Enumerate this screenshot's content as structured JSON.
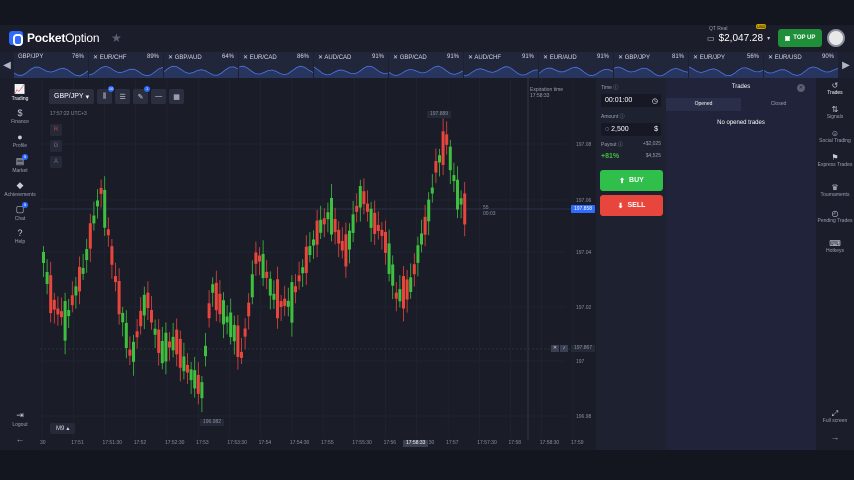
{
  "header": {
    "logo_bold": "Pocket",
    "logo_light": "Option",
    "account_type": "QT Real",
    "balance": "$2,047.28",
    "currency_badge": "USD",
    "topup_label": "TOP UP"
  },
  "assets": [
    {
      "name": "GBP/JPY",
      "pct": "76%"
    },
    {
      "name": "EUR/CHF",
      "pct": "89%"
    },
    {
      "name": "GBP/AUD",
      "pct": "64%"
    },
    {
      "name": "EUR/CAD",
      "pct": "86%"
    },
    {
      "name": "AUD/CAD",
      "pct": "91%"
    },
    {
      "name": "GBP/CAD",
      "pct": "91%"
    },
    {
      "name": "AUD/CHF",
      "pct": "91%"
    },
    {
      "name": "EUR/AUD",
      "pct": "91%"
    },
    {
      "name": "GBP/JPY",
      "pct": "81%"
    },
    {
      "name": "EUR/JPY",
      "pct": "56%"
    },
    {
      "name": "EUR/USD",
      "pct": "90%"
    }
  ],
  "left_sidebar": {
    "trading": "Trading",
    "finance": "Finance",
    "profile": "Profile",
    "market": "Market",
    "achievements": "Achievements",
    "chat": "Chat",
    "help": "Help",
    "logout": "Logout",
    "market_badge": "5",
    "chat_badge": "5"
  },
  "chart_toolbar": {
    "pair": "GBP/JPY",
    "indicators_badge": "10",
    "draw_badge": "1",
    "timestamp": "17:57:22 UTC+3",
    "timeframe": "M9"
  },
  "chart_labels": {
    "expiration_label": "Expiration time",
    "expiration_time": "17:58:33",
    "current_price": "197.858",
    "high_tag": "197.889",
    "low_tag": "196.982",
    "mid_tag": "197.867",
    "countdown_top": "55",
    "countdown_bottom": "00:03",
    "current_time": "17:58:33"
  },
  "price_axis": [
    "197.08",
    "197.06",
    "197.04",
    "197.02",
    "197",
    "196.98"
  ],
  "time_axis": [
    "30",
    "17:51",
    "17:51:30",
    "17:52",
    "17:52:30",
    "17:53",
    "17:53:30",
    "17:54",
    "17:54:30",
    "17:55",
    "17:55:30",
    "17:56",
    "17:56:30",
    "17:57",
    "17:57:30",
    "17:58",
    "17:58:30",
    "17:59"
  ],
  "trade_panel": {
    "time_label": "Time",
    "time_value": "00:01:00",
    "amount_label": "Amount",
    "amount_value": "2,500",
    "payout_label": "Payout",
    "payout_plus": "+$2,025",
    "payout_pct": "+81%",
    "payout_total": "$4,525",
    "buy_label": "BUY",
    "sell_label": "SELL"
  },
  "trades_panel": {
    "title": "Trades",
    "tab_opened": "Opened",
    "tab_closed": "Closed",
    "empty_text": "No opened trades"
  },
  "right_sidebar": {
    "trades": "Trades",
    "signals": "Signals",
    "social": "Social Trading",
    "express": "Express Trades",
    "tournaments": "Tournaments",
    "pending": "Pending Trades",
    "hotkeys": "Hotkeys",
    "fullscreen": "Full screen"
  },
  "colors": {
    "up": "#3fbf3f",
    "down": "#e8453c",
    "accent": "#2f6bff",
    "buy": "#2fbf4a",
    "sell": "#e8453c"
  },
  "icons": [
    "star-icon",
    "wallet-icon",
    "avatar",
    "chevron-left-icon",
    "chevron-right-icon",
    "chart-icon",
    "dollar-icon",
    "user-icon",
    "cart-icon",
    "diamond-icon",
    "chat-icon",
    "help-icon",
    "logout-icon",
    "clock-icon",
    "history-icon",
    "signals-icon",
    "social-icon",
    "express-icon",
    "trophy-icon",
    "pending-icon",
    "keyboard-icon",
    "fullscreen-icon"
  ]
}
